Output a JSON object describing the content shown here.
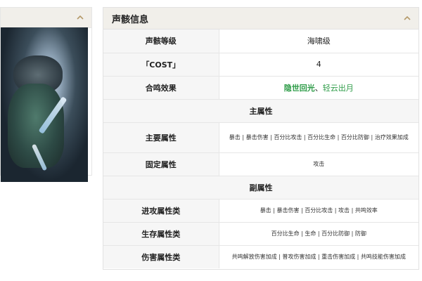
{
  "colors": {
    "accent_green": "#2e9c48",
    "header_bg": "#f1efea",
    "label_bg": "#f6f6f6"
  },
  "icons": {
    "collapse": "chevron-up-icon"
  },
  "panel": {
    "title": "声骸信息",
    "rows": {
      "level_label": "声骸等级",
      "level_value": "海啸级",
      "cost_label": "「COST」",
      "cost_value": "4",
      "sonata_label": "合鸣效果",
      "sonata_value_1": "隐世回光",
      "sonata_sep": "、",
      "sonata_value_2": "轻云出月",
      "main_section": "主属性",
      "main_attr_label": "主要属性",
      "main_attr_value": "暴击 | 暴击伤害 | 百分比攻击 | 百分比生命 | 百分比防御 | 治疗效果加成",
      "fixed_attr_label": "固定属性",
      "fixed_attr_value": "攻击",
      "sub_section": "副属性",
      "offense_label": "进攻属性类",
      "offense_value": "暴击 | 暴击伤害 | 百分比攻击 | 攻击 | 共鸣效率",
      "survival_label": "生存属性类",
      "survival_value": "百分比生命 | 生命 | 百分比防御 | 防御",
      "damage_label": "伤害属性类",
      "damage_value": "共鸣解放伤害加成 | 普攻伤害加成 | 重击伤害加成 | 共鸣技能伤害加成"
    }
  }
}
